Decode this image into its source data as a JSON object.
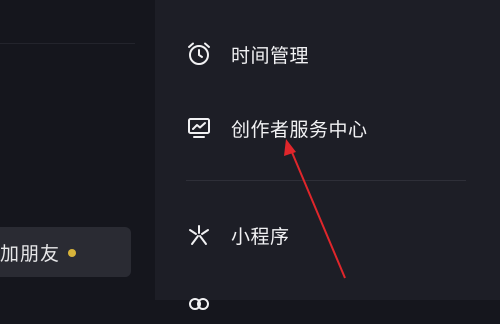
{
  "left": {
    "add_friend_label": "加朋友"
  },
  "menu": {
    "time_management": "时间管理",
    "creator_center": "创作者服务中心",
    "mini_program": "小程序"
  },
  "icons": {
    "time_management": "alarm-clock-icon",
    "creator_center": "chart-monitor-icon",
    "mini_program": "mini-program-icon",
    "partial": "circle-icon"
  },
  "colors": {
    "background_left": "#15161d",
    "background_right": "#1d1e26",
    "notification_dot": "#d7b33a",
    "annotation_arrow": "#e0262b"
  }
}
